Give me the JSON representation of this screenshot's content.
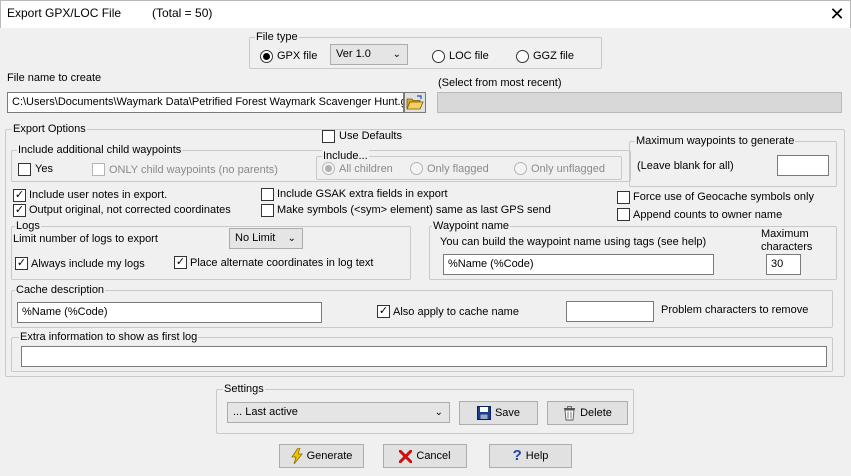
{
  "window": {
    "title": "Export GPX/LOC File",
    "total": "(Total = 50)",
    "close_glyph": "✕"
  },
  "file_type": {
    "legend": "File type",
    "gpx_label": "GPX file",
    "gpx_version": "Ver 1.0",
    "loc_label": "LOC file",
    "ggz_label": "GGZ file"
  },
  "file_name": {
    "label": "File name to create",
    "value": "C:\\Users\\Documents\\Waymark Data\\Petrified Forest Waymark Scavenger Hunt.gpx",
    "recent_label": "(Select from most recent)",
    "browse_icon": "open-folder-icon"
  },
  "export_options": {
    "legend": "Export Options",
    "use_defaults": "Use Defaults",
    "child": {
      "legend": "Include additional child waypoints",
      "yes": "Yes",
      "only_child": "ONLY child waypoints (no parents)",
      "include_legend": "Include...",
      "all_children": "All children",
      "only_flagged": "Only flagged",
      "only_unflagged": "Only unflagged"
    },
    "max_wpts": {
      "legend": "Maximum waypoints to generate",
      "hint": "(Leave blank for all)",
      "value": ""
    },
    "include_user_notes": "Include user notes in export.",
    "output_original": "Output original, not corrected coordinates",
    "gsak_extra": "Include GSAK extra fields in export",
    "make_symbols": "Make symbols (<sym> element) same as last GPS send",
    "force_symbols": "Force use of Geocache symbols only",
    "append_counts": "Append counts to owner name"
  },
  "logs": {
    "legend": "Logs",
    "limit_label": "Limit number of logs to export",
    "limit_value": "No Limit",
    "always_include": "Always include my logs",
    "place_alternate": "Place alternate coordinates in log text"
  },
  "waypoint_name": {
    "legend": "Waypoint name",
    "hint": "You can build the waypoint name using tags (see help)",
    "value": "%Name (%Code)",
    "max_chars_label_1": "Maximum",
    "max_chars_label_2": "characters",
    "max_chars_value": "30"
  },
  "cache_description": {
    "legend": "Cache description",
    "value": "%Name (%Code)",
    "also_apply": "Also apply to cache name",
    "problem_value": "",
    "problem_label": "Problem characters to remove"
  },
  "extra_info": {
    "legend": "Extra information to show as first log",
    "value": ""
  },
  "settings": {
    "legend": "Settings",
    "selected": "... Last active",
    "save_label": "Save",
    "delete_label": "Delete"
  },
  "actions": {
    "generate_label": "Generate",
    "cancel_label": "Cancel",
    "help_label": "Help"
  }
}
